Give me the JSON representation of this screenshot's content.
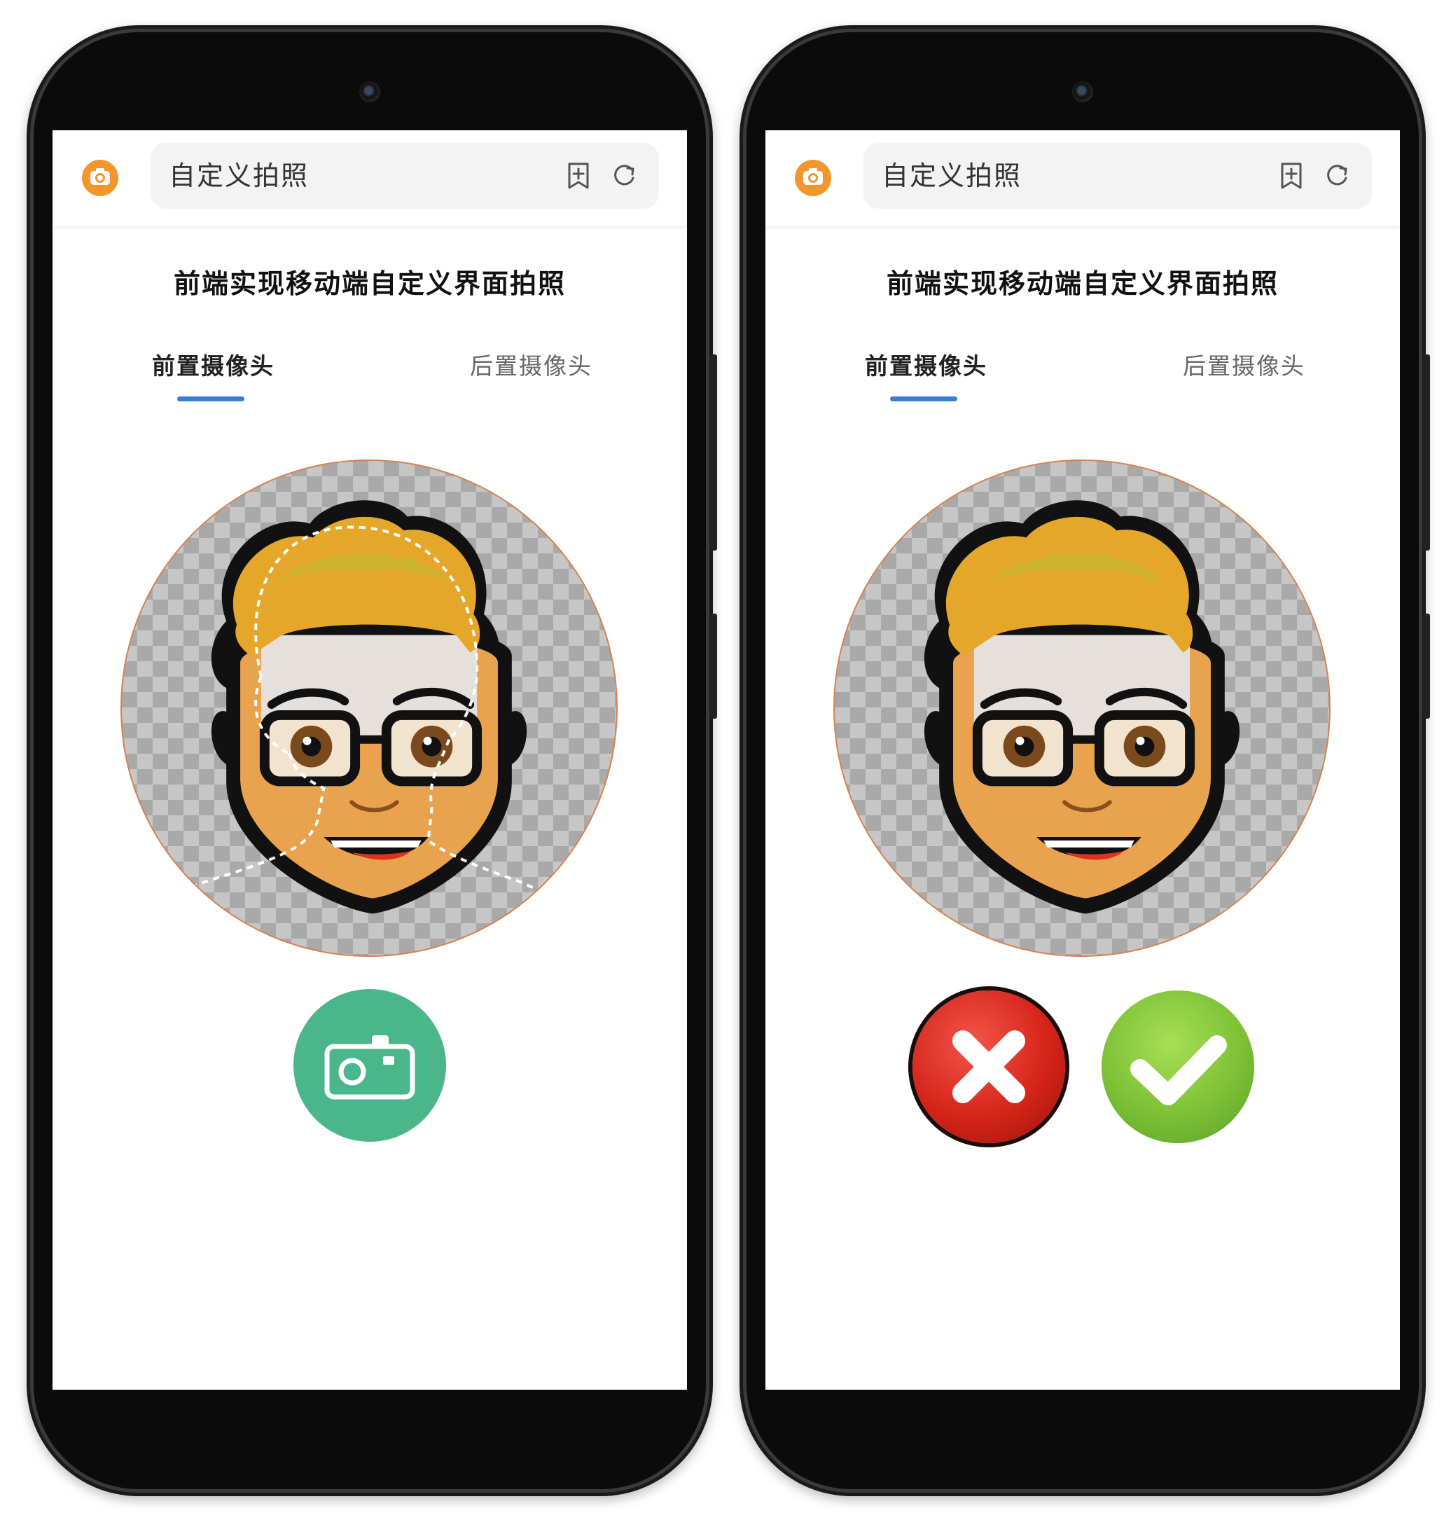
{
  "app": {
    "title": "自定义拍照",
    "heading": "前端实现移动端自定义界面拍照"
  },
  "tabs": [
    {
      "label": "前置摄像头",
      "active": true
    },
    {
      "label": "后置摄像头",
      "active": false
    }
  ],
  "colors": {
    "logo": "#f3962d",
    "tab_underline": "#3a7cd8",
    "shutter": "#4bb68a",
    "cancel": "#d6241a",
    "confirm": "#7cc134",
    "viewfinder_border": "#d7824f"
  },
  "icons": {
    "logo": "camera-icon",
    "bookmark": "bookmark-add-icon",
    "refresh": "refresh-icon",
    "shutter": "camera-icon",
    "cancel": "close-icon",
    "confirm": "check-icon"
  },
  "screens": [
    {
      "state": "capture",
      "controls": [
        "shutter-button"
      ]
    },
    {
      "state": "review",
      "controls": [
        "cancel-button",
        "confirm-button"
      ]
    }
  ]
}
